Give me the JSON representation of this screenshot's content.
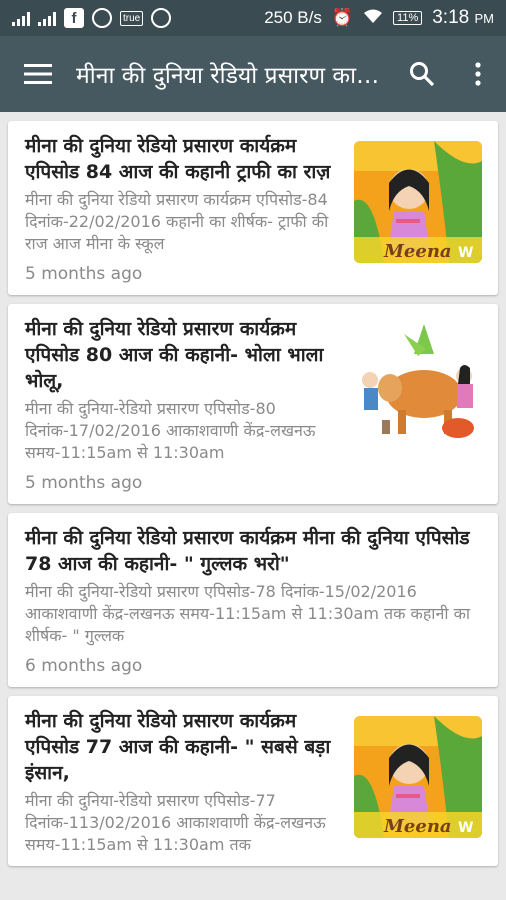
{
  "status_bar": {
    "net_speed": "250 B/s",
    "battery": "11%",
    "time": "3:18",
    "time_suffix": "PM",
    "true_badge": "true",
    "fb_letter": "f"
  },
  "app_bar": {
    "title": "मीना की दुनिया रेडियो प्रसारण कार्यक्रम"
  },
  "articles": [
    {
      "title": "मीना की दुनिया रेडियो प्रसारण कार्यक्रम एपिसोड 84 आज की कहानी ट्राफी का राज़",
      "summary": "मीना की दुनिया रेडियो प्रसारण कार्यक्रम एपिसोड-84 दिनांक-22/02/2016 कहानी का शीर्षक- ट्राफी की राज   आज मीना के स्कूल",
      "time": "5 months ago",
      "thumb_caption": "Meena",
      "has_thumb": true
    },
    {
      "title": "मीना की दुनिया रेडियो प्रसारण कार्यक्रम एपिसोड 80 आज की कहानी- भोला भाला भोलू,",
      "summary": "मीना की दुनिया-रेडियो प्रसारण एपिसोड-80 दिनांक-17/02/2016 आकाशवाणी केंद्र-लखनऊ समय-11:15am से 11:30am",
      "time": "5 months ago",
      "has_thumb": true
    },
    {
      "title": "मीना की दुनिया रेडियो प्रसारण कार्यक्रम मीना की दुनिया एपिसोड 78 आज की कहानी- \" गुल्लक भरो\"",
      "summary": "मीना की दुनिया-रेडियो प्रसारण एपिसोड-78 दिनांक-15/02/2016 आकाशवाणी केंद्र-लखनऊ समय-11:15am से 11:30am तक कहानी का शीर्षक- \" गुल्लक",
      "time": "6 months ago",
      "has_thumb": false
    },
    {
      "title": "मीना की दुनिया रेडियो प्रसारण कार्यक्रम एपिसोड 77 आज की कहानी- \" सबसे बड़ा इंसान,",
      "summary": "मीना की दुनिया-रेडियो प्रसारण एपिसोड-77 दिनांक-113/02/2016 आकाशवाणी केंद्र-लखनऊ समय-11:15am से 11:30am तक",
      "time": "",
      "thumb_caption": "Meena",
      "has_thumb": true
    }
  ]
}
